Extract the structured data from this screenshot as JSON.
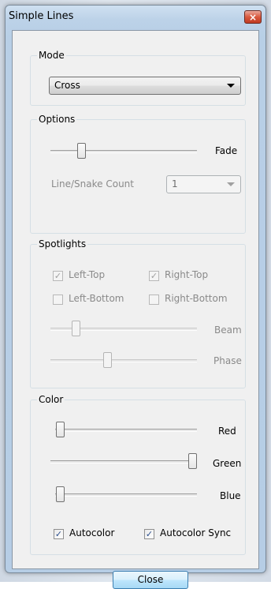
{
  "window": {
    "title": "Simple Lines",
    "close_glyph": "×"
  },
  "mode": {
    "label": "Mode",
    "selected": "Cross"
  },
  "options": {
    "label": "Options",
    "fade_label": "Fade",
    "fade_level": 0.19,
    "count_label": "Line/Snake Count",
    "count_value": "1"
  },
  "spotlights": {
    "label": "Spotlights",
    "left_top": {
      "label": "Left-Top",
      "checked": true,
      "check_glyph": "✓"
    },
    "right_top": {
      "label": "Right-Top",
      "checked": true,
      "check_glyph": "✓"
    },
    "left_bottom": {
      "label": "Left-Bottom",
      "checked": false
    },
    "right_bottom": {
      "label": "Right-Bottom",
      "checked": false
    },
    "beam_label": "Beam",
    "beam_level": 0.15,
    "phase_label": "Phase",
    "phase_level": 0.38
  },
  "color": {
    "label": "Color",
    "red_label": "Red",
    "red_level": 0.0,
    "green_label": "Green",
    "green_level": 1.0,
    "blue_label": "Blue",
    "blue_level": 0.0,
    "autocolor": {
      "label": "Autocolor",
      "checked": true,
      "check_glyph": "✓"
    },
    "autocolor_sync": {
      "label": "Autocolor Sync",
      "checked": true,
      "check_glyph": "✓"
    }
  },
  "buttons": {
    "close_label": "Close"
  },
  "colors": {
    "title_bar": "#bcd2e8",
    "close_button": "#d9593f",
    "dialog_bg": "#f0f0f0",
    "button_accent": "#a7d9f5"
  }
}
